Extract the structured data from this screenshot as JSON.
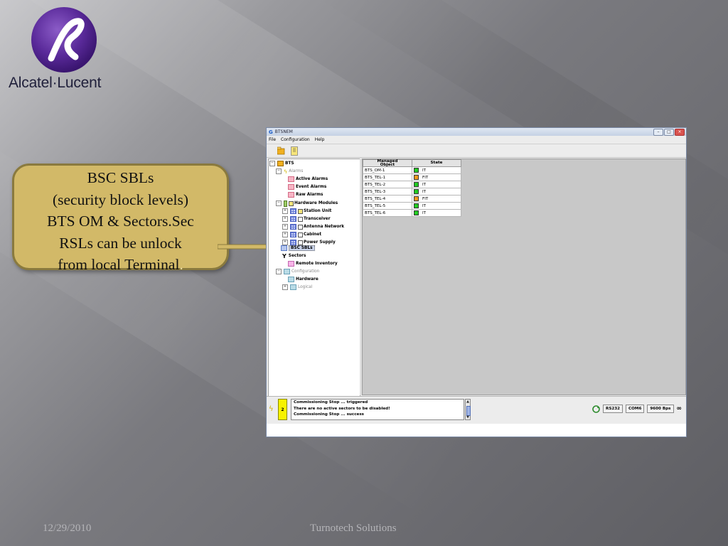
{
  "logo": {
    "brand_text": "Alcatel·Lucent"
  },
  "callout": {
    "lines": [
      "BSC SBLs",
      "(security block levels)",
      "BTS OM & Sectors.Sec",
      "RSLs can be unlock",
      "from local Terminal"
    ],
    "trailing_dot": "."
  },
  "app": {
    "title": "BTSNEM",
    "menu": {
      "file": "File",
      "configuration": "Configuration",
      "help": "Help"
    },
    "tree": {
      "root": "BTS",
      "alarms": "Alarms",
      "active_alarms": "Active Alarms",
      "event_alarms": "Event Alarms",
      "raw_alarms": "Raw Alarms",
      "hardware_modules": "Hardware Modules",
      "station_unit": "Station Unit",
      "transceiver": "Transceiver",
      "antenna_network": "Antenna Network",
      "cabinet": "Cabinet",
      "power_supply": "Power Supply",
      "bsc_sbls": "BSC SBLs",
      "sectors": "Sectors",
      "remote_inventory": "Remote Inventory",
      "configuration": "Configuration",
      "hardware": "Hardware",
      "logical": "Logical"
    },
    "table": {
      "col_object": "Managed\nObject",
      "col_state": "State",
      "rows": [
        {
          "object": "BTS_OM-1",
          "state": "IT",
          "color": "#22cc22"
        },
        {
          "object": "BTS_TEL-1",
          "state": "FIT",
          "color": "#f59a1e"
        },
        {
          "object": "BTS_TEL-2",
          "state": "IT",
          "color": "#22cc22"
        },
        {
          "object": "BTS_TEL-3",
          "state": "IT",
          "color": "#22cc22"
        },
        {
          "object": "BTS_TEL-4",
          "state": "FIT",
          "color": "#f59a1e"
        },
        {
          "object": "BTS_TEL-5",
          "state": "IT",
          "color": "#22cc22"
        },
        {
          "object": "BTS_TEL-6",
          "state": "IT",
          "color": "#22cc22"
        }
      ]
    },
    "status": {
      "alarm_count": "2",
      "messages": [
        "Commissioning Stop ... triggered",
        "There are no active sectors to be disabled!",
        "Commissioning Stop ... success"
      ],
      "port": "RS232",
      "com": "COM6",
      "baud": "9600 Bps"
    }
  },
  "footer": {
    "date": "12/29/2010",
    "company": "Turnotech Solutions"
  }
}
